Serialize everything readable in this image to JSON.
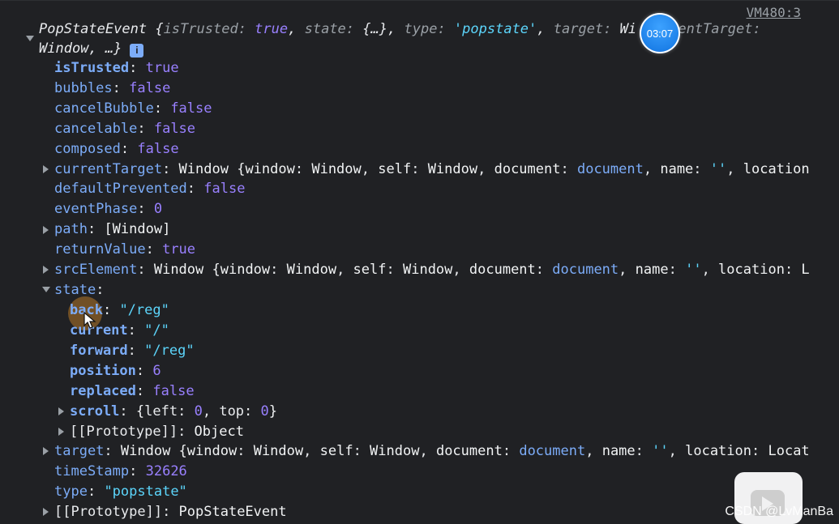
{
  "source": {
    "label": "VM480:3"
  },
  "summary": {
    "class_name": "PopStateEvent",
    "prefix": "{",
    "parts": [
      {
        "key": "isTrusted",
        "sep": ": ",
        "value": "true",
        "kind": "bool"
      },
      {
        "key": "state",
        "sep": ": ",
        "value": "{…}",
        "kind": "obj"
      },
      {
        "key": "type",
        "sep": ": ",
        "value": "'popstate'",
        "kind": "str"
      },
      {
        "key": "target",
        "sep": ": ",
        "value": "Wi",
        "kind": "obj"
      },
      {
        "key": "currentTarget",
        "sep": ":",
        "value": "",
        "kind": "obj"
      }
    ],
    "continuation": "Window, …}",
    "info_badge": "i"
  },
  "timer": {
    "label": "03:07"
  },
  "watermark": {
    "label": "CSDN @LvManBa"
  },
  "props": {
    "isTrusted": {
      "key": "isTrusted",
      "value": "true"
    },
    "bubbles": {
      "key": "bubbles",
      "value": "false"
    },
    "cancelBubble": {
      "key": "cancelBubble",
      "value": "false"
    },
    "cancelable": {
      "key": "cancelable",
      "value": "false"
    },
    "composed": {
      "key": "composed",
      "value": "false"
    },
    "currentTarget": {
      "key": "currentTarget",
      "value_prefix": "Window {",
      "fields": [
        {
          "key": "window",
          "value": "Window"
        },
        {
          "key": "self",
          "value": "Window"
        },
        {
          "key": "document",
          "value": "document"
        },
        {
          "key": "name",
          "value": "''"
        },
        {
          "key": "location",
          "value": ""
        }
      ]
    },
    "defaultPrevented": {
      "key": "defaultPrevented",
      "value": "false"
    },
    "eventPhase": {
      "key": "eventPhase",
      "value": "0"
    },
    "path": {
      "key": "path",
      "value": "[Window]"
    },
    "returnValue": {
      "key": "returnValue",
      "value": "true"
    },
    "srcElement": {
      "key": "srcElement",
      "value_prefix": "Window {",
      "fields": [
        {
          "key": "window",
          "value": "Window"
        },
        {
          "key": "self",
          "value": "Window"
        },
        {
          "key": "document",
          "value": "document"
        },
        {
          "key": "name",
          "value": "''"
        },
        {
          "key": "location",
          "value": "L"
        }
      ]
    },
    "state": {
      "key": "state",
      "children": {
        "back": {
          "key": "back",
          "value": "\"/reg\""
        },
        "current": {
          "key": "current",
          "value": "\"/\""
        },
        "forward": {
          "key": "forward",
          "value": "\"/reg\""
        },
        "position": {
          "key": "position",
          "value": "6"
        },
        "replaced": {
          "key": "replaced",
          "value": "false"
        },
        "scroll": {
          "key": "scroll",
          "value_prefix": "{",
          "left_key": "left",
          "left_value": "0",
          "top_key": "top",
          "top_value": "0",
          "value_suffix": "}"
        },
        "prototype": {
          "key": "[[Prototype]]",
          "value": "Object"
        }
      }
    },
    "target": {
      "key": "target",
      "value_prefix": "Window {",
      "fields": [
        {
          "key": "window",
          "value": "Window"
        },
        {
          "key": "self",
          "value": "Window"
        },
        {
          "key": "document",
          "value": "document"
        },
        {
          "key": "name",
          "value": "''"
        },
        {
          "key": "location",
          "value": "Locat"
        }
      ]
    },
    "timeStamp": {
      "key": "timeStamp",
      "value": "32626"
    },
    "type": {
      "key": "type",
      "value": "\"popstate\""
    },
    "prototype": {
      "key": "[[Prototype]]",
      "value": "PopStateEvent"
    }
  },
  "colors": {
    "background": "#202124",
    "key": "#7cacf8",
    "boolean": "#9980ff",
    "string": "#5cd5fb",
    "text": "#e8eaed"
  }
}
